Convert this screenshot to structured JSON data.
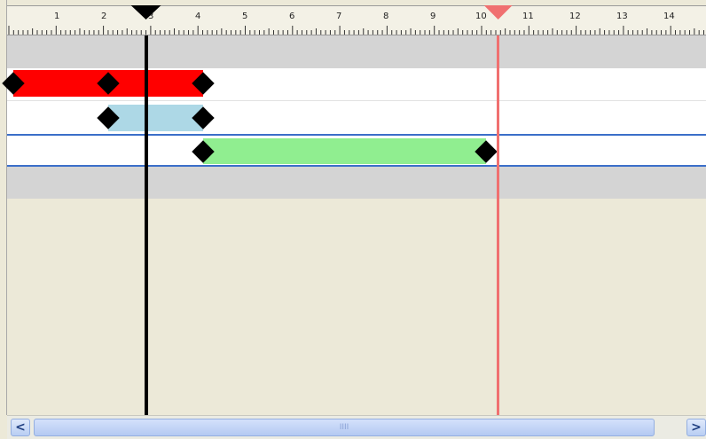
{
  "ruler": {
    "labels": [
      "1",
      "2",
      "3",
      "4",
      "5",
      "6",
      "7",
      "8",
      "9",
      "10",
      "11",
      "12",
      "13",
      "14"
    ]
  },
  "scrollbar": {
    "left_arrow": "<",
    "right_arrow": ">",
    "thumb_grip": "IIII"
  },
  "colors": {
    "clip_1": "#ff0000",
    "clip_2": "#add8e6",
    "clip_3": "#90ee90",
    "playhead": "#000000",
    "end_marker": "#f07070",
    "selected_track_border": "#3b6fc9",
    "group_row": "#d4d4d4"
  },
  "tracks": [
    {
      "clip_color": "red",
      "start": 0.1,
      "end": 4.1,
      "keyframes": [
        0.1,
        2.1,
        4.1
      ]
    },
    {
      "clip_color": "lightblue",
      "start": 2.1,
      "end": 4.1,
      "keyframes": [
        2.1,
        4.1
      ]
    },
    {
      "clip_color": "lightgreen",
      "start": 4.1,
      "end": 10.1,
      "keyframes": [
        4.1,
        10.1
      ],
      "selected": true
    }
  ],
  "playhead_time": 2.9,
  "end_time": 10.35
}
